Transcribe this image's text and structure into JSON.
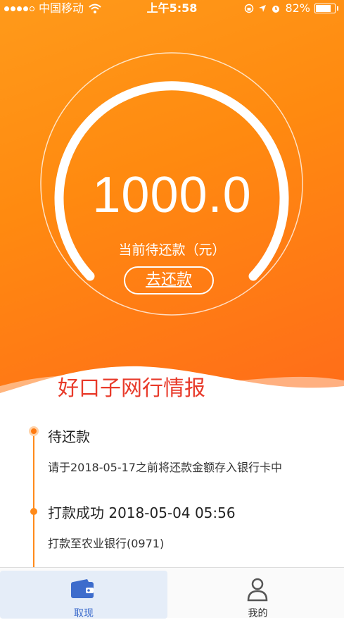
{
  "status_bar": {
    "carrier": "中国移动",
    "time": "上午5:58",
    "battery_percent": "82%",
    "battery_level": 0.82
  },
  "loan": {
    "amount": "1000.0",
    "amount_label": "当前待还款（元）",
    "repay_button": "去还款"
  },
  "watermark": "好口子网行情报",
  "timeline": [
    {
      "title": "待还款",
      "desc": "请于2018-05-17之前将还款金额存入银行卡中"
    },
    {
      "title": "打款成功 2018-05-04 05:56",
      "desc": "打款至农业银行(0971)"
    }
  ],
  "tabs": [
    {
      "label": "取现",
      "icon": "wallet-icon",
      "active": true
    },
    {
      "label": "我的",
      "icon": "user-icon",
      "active": false
    }
  ],
  "colors": {
    "accent": "#ff8a1a",
    "tab_active_text": "#3d6ccc",
    "tab_inactive_text": "#333333"
  }
}
